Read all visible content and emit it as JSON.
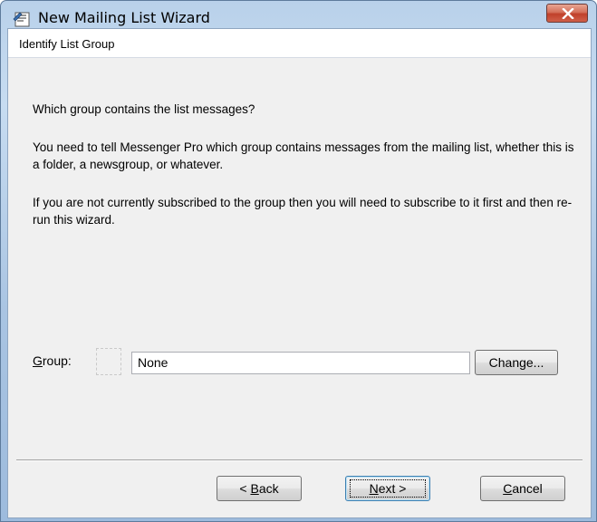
{
  "window": {
    "title": "New Mailing List Wizard",
    "icon": "wizard-app-icon",
    "close_icon": "close-icon"
  },
  "page": {
    "header": "Identify List Group",
    "question": "Which group contains the list messages?",
    "para1": "You need to tell Messenger Pro which group contains messages from the mailing list, whether this is a folder, a newsgroup, or whatever.",
    "para2": "If you are not currently subscribed to the group then you will need to subscribe to it first and then re-run this wizard."
  },
  "group": {
    "label_prefix": "G",
    "label_rest": "roup:",
    "value": "None",
    "change_label": "Change..."
  },
  "buttons": {
    "back_prefix": "< ",
    "back_acc": "B",
    "back_rest": "ack",
    "next_acc": "N",
    "next_rest": "ext >",
    "cancel_acc": "C",
    "cancel_rest": "ancel"
  }
}
